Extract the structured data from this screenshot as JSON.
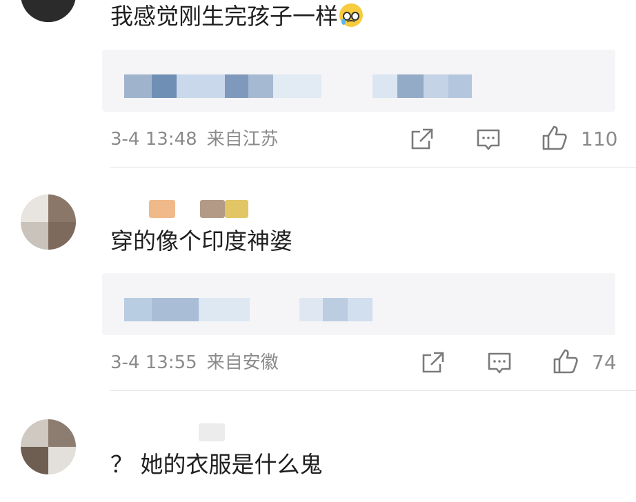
{
  "comments": [
    {
      "text": "我感觉刚生完孩子一样",
      "emoji": "crying-face-emoji",
      "timestamp": "3-4 13:48",
      "location": "来自江苏",
      "likes": "110"
    },
    {
      "text": "穿的像个印度神婆",
      "timestamp": "3-4 13:55",
      "location": "来自安徽",
      "likes": "74"
    },
    {
      "text": "？ 她的衣服是什么鬼"
    }
  ],
  "icons": {
    "share": "share-icon",
    "reply": "comment-icon",
    "like": "thumbs-up-icon"
  },
  "colors": {
    "text": "#1f1f1f",
    "meta": "#8a8a8a",
    "reply_background": "#f5f5f7"
  }
}
